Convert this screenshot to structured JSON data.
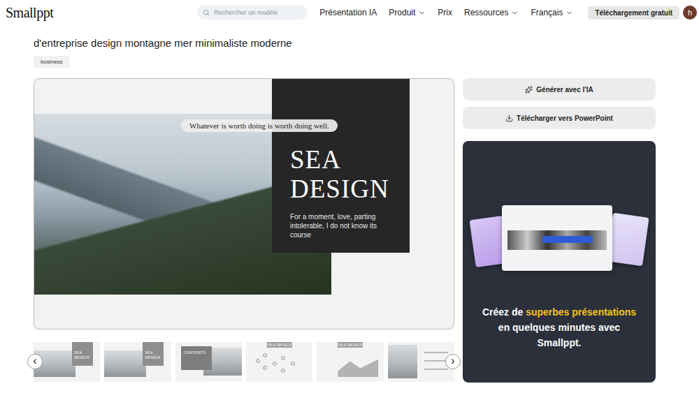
{
  "header": {
    "logo": "Smallppt",
    "search": {
      "placeholder": "Rechercher un modèle"
    },
    "nav": [
      {
        "label": "Présentation IA",
        "dropdown": false
      },
      {
        "label": "Produit",
        "dropdown": true
      },
      {
        "label": "Prix",
        "dropdown": false
      },
      {
        "label": "Ressources",
        "dropdown": true
      },
      {
        "label": "Français",
        "dropdown": true
      }
    ],
    "download_button": "Téléchargement gratuit",
    "avatar": "h"
  },
  "template": {
    "title": "d'entreprise design montagne mer minimaliste moderne",
    "tags": [
      "business"
    ]
  },
  "slide": {
    "quote": "Whatever is worth doing is worth doing well.",
    "heading": [
      "SEA",
      "DESIGN"
    ],
    "subtitle": "For a moment, love, parting intolerable, I do not know its course"
  },
  "carousel": {
    "prev": "‹",
    "next": "›",
    "thumbnails": [
      {
        "kind": "cover",
        "label": "SEA DESIGN"
      },
      {
        "kind": "cover",
        "label": "SEA DESIGN"
      },
      {
        "kind": "contents",
        "label": "CONTENTS"
      },
      {
        "kind": "diagram",
        "label": "SEA DESIGN"
      },
      {
        "kind": "chart",
        "label": "SEA DESIGN"
      },
      {
        "kind": "list"
      }
    ]
  },
  "actions": [
    {
      "label": "Générer avec l'IA",
      "kind": "generate"
    },
    {
      "label": "Télécharger vers PowerPoint",
      "kind": "download"
    }
  ],
  "promo": {
    "text_before": "Créez de ",
    "highlight": "superbes présentations",
    "text_after": " en quelques minutes avec Smallppt."
  }
}
